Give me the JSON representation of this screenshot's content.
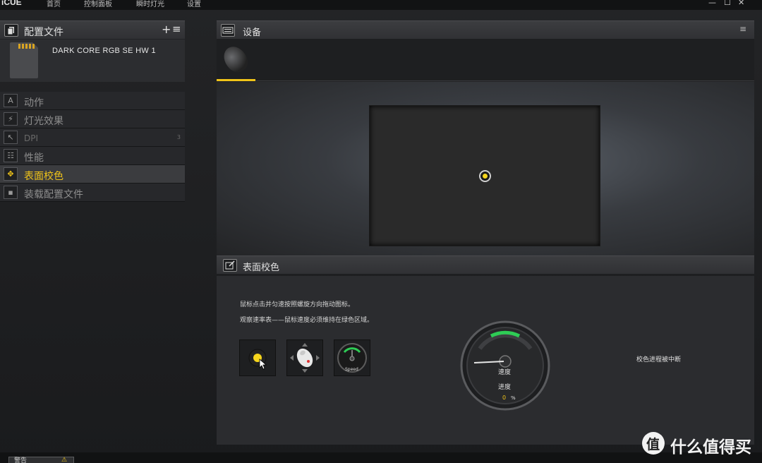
{
  "app": {
    "title": "iCUE"
  },
  "nav": [
    "首页",
    "控制面板",
    "瞬时灯光",
    "设置"
  ],
  "window_controls": {
    "minimize": "—",
    "maximize": "☐",
    "close": "✕"
  },
  "profiles": {
    "title": "配置文件",
    "add_label": "+",
    "menu_label": "≡",
    "profile_name": "DARK CORE RGB SE HW 1"
  },
  "menu": [
    {
      "label": "动作",
      "icon": "A",
      "icon_name": "action-icon"
    },
    {
      "label": "灯光效果",
      "icon": "⚡",
      "icon_name": "lightning-icon"
    },
    {
      "label": "DPI",
      "icon": "↖",
      "icon_name": "cursor-icon",
      "badge": "3"
    },
    {
      "label": "性能",
      "icon": "☷",
      "icon_name": "performance-icon"
    },
    {
      "label": "表面校色",
      "icon": "✥",
      "icon_name": "surface-icon"
    },
    {
      "label": "装载配置文件",
      "icon": "▪",
      "icon_name": "load-profile-icon"
    }
  ],
  "devices": {
    "title": "设备",
    "menu_label": "≡"
  },
  "calibration": {
    "title": "表面校色",
    "instruction_1": "鼠标点击并匀速按照螺旋方向拖动图标。",
    "instruction_2": "观察速率表——鼠标速度必须维持在绿色区域。",
    "step_speed_label": "Speed",
    "gauge_speed_label": "速度",
    "progress_label": "进度",
    "progress_value": "0",
    "progress_unit": "%",
    "progress_fraction": 0,
    "status": "校色进程被中断"
  },
  "footer": {
    "warning_label": "警告",
    "warning_icon": "⚠"
  },
  "watermark": {
    "logo": "值",
    "text": "什么值得买"
  },
  "colors": {
    "accent": "#f0c419",
    "green": "#2ecc55"
  }
}
